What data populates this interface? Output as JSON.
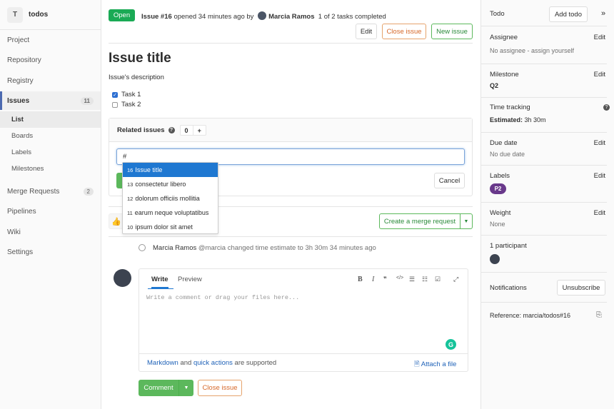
{
  "project": {
    "initial": "T",
    "name": "todos"
  },
  "nav": {
    "project": "Project",
    "repository": "Repository",
    "registry": "Registry",
    "issues": "Issues",
    "issues_count": "11",
    "list": "List",
    "boards": "Boards",
    "labels": "Labels",
    "milestones": "Milestones",
    "merge_requests": "Merge Requests",
    "merge_requests_count": "2",
    "pipelines": "Pipelines",
    "wiki": "Wiki",
    "settings": "Settings"
  },
  "issue_header": {
    "status": "Open",
    "issue_ref": "Issue #16",
    "opened_text": "opened 34 minutes ago by",
    "author": "Marcia Ramos",
    "tasks_text": "1 of 2 tasks completed",
    "edit_label": "Edit",
    "close_label": "Close issue",
    "new_label": "New issue"
  },
  "issue": {
    "title": "Issue title",
    "description": "Issue's description",
    "tasks": [
      {
        "label": "Task 1",
        "checked": true
      },
      {
        "label": "Task 2",
        "checked": false
      }
    ]
  },
  "related": {
    "heading": "Related issues",
    "count": "0",
    "add_symbol": "+",
    "input_value": "#",
    "cancel_label": "Cancel",
    "suggestions": [
      {
        "num": "16",
        "title": "Issue title"
      },
      {
        "num": "13",
        "title": "consectetur libero"
      },
      {
        "num": "12",
        "title": "dolorum officiis mollitia"
      },
      {
        "num": "11",
        "title": "earum neque voluptatibus"
      },
      {
        "num": "10",
        "title": "ipsum dolor sit amet"
      }
    ]
  },
  "merge": {
    "create_label": "Create a merge request"
  },
  "timeline": {
    "author": "Marcia Ramos",
    "handle": "@marcia",
    "text": "changed time estimate to 3h 30m 34 minutes ago"
  },
  "editor": {
    "tab_write": "Write",
    "tab_preview": "Preview",
    "placeholder": "Write a comment or drag your files here...",
    "md_link": "Markdown",
    "md_and": "and",
    "qa_link": "quick actions",
    "md_tail": "are supported",
    "attach_label": "Attach a file",
    "toolbar": {
      "bold": "B",
      "italic": "I",
      "quote": "❞",
      "code": "</>",
      "ul": "☰",
      "ol": "☷",
      "task": "☑",
      "fullscreen": "⤢"
    }
  },
  "comment_actions": {
    "comment_label": "Comment",
    "close_label": "Close issue"
  },
  "right_sidebar": {
    "todo_label": "Todo",
    "add_todo_label": "Add todo",
    "collapse_glyph": "»",
    "assignee_label": "Assignee",
    "assignee_value": "No assignee - assign yourself",
    "milestone_label": "Milestone",
    "milestone_value": "Q2",
    "time_label": "Time tracking",
    "time_value_label": "Estimated:",
    "time_value": "3h 30m",
    "due_label": "Due date",
    "due_value": "No due date",
    "labels_label": "Labels",
    "label_p2": "P2",
    "weight_label": "Weight",
    "weight_value": "None",
    "participants_label": "1 participant",
    "notifications_label": "Notifications",
    "unsubscribe_label": "Unsubscribe",
    "reference": "Reference: marcia/todos#16",
    "edit_label": "Edit"
  },
  "colors": {
    "accent": "#1f78d1",
    "open": "#1aaa55",
    "label_p2": "#69398b",
    "close": "#d6682a",
    "grammarly": "#15c39a"
  }
}
